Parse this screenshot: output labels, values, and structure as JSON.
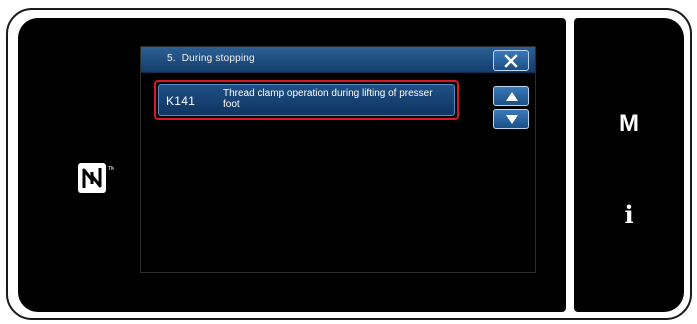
{
  "dialog": {
    "number": "5.",
    "title": "During stopping",
    "close_icon": "close-icon"
  },
  "items": [
    {
      "code": "K141",
      "label": "Thread clamp operation during lifting of presser foot",
      "selected": true
    }
  ],
  "scroll": {
    "up_icon": "triangle-up-icon",
    "down_icon": "triangle-down-icon"
  },
  "side_panel": {
    "m_key": "M",
    "info_key": "i"
  },
  "colors": {
    "header_blue": "#1f4f86",
    "highlight_red": "#d9182b",
    "screen_black": "#000000"
  }
}
